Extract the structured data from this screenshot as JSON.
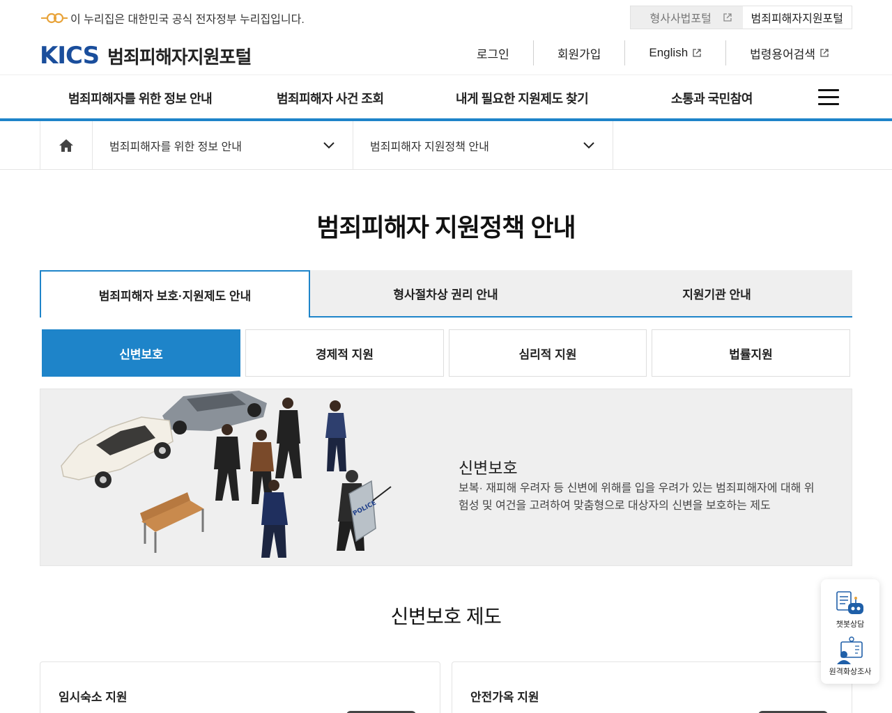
{
  "gov_bar": {
    "notice": "이 누리집은 대한민국 공식 전자정부 누리집입니다.",
    "links": [
      {
        "label": "형사사법포털"
      },
      {
        "label": "범죄피해자지원포털"
      }
    ]
  },
  "header": {
    "logo_mark": "KICS",
    "logo_text": "범죄피해자지원포털",
    "util_links": [
      {
        "label": "로그인"
      },
      {
        "label": "회원가입"
      },
      {
        "label": "English"
      },
      {
        "label": "법령용어검색"
      }
    ]
  },
  "gnb": {
    "items": [
      {
        "label": "범죄피해자를 위한 정보 안내"
      },
      {
        "label": "범죄피해자 사건 조회"
      },
      {
        "label": "내게 필요한 지원제도 찾기"
      },
      {
        "label": "소통과 국민참여"
      }
    ]
  },
  "breadcrumb": {
    "level1": "범죄피해자를 위한 정보 안내",
    "level2": "범죄피해자 지원정책 안내"
  },
  "page": {
    "title": "범죄피해자 지원정책 안내"
  },
  "tabs": [
    {
      "label": "범죄피해자 보호·지원제도 안내"
    },
    {
      "label": "형사절차상 권리 안내"
    },
    {
      "label": "지원기관 안내"
    }
  ],
  "subtabs": [
    {
      "label": "신변보호"
    },
    {
      "label": "경제적 지원"
    },
    {
      "label": "심리적 지원"
    },
    {
      "label": "법률지원"
    }
  ],
  "banner": {
    "title": "신변보호",
    "description": "보복· 재피해 우려자 등 신변에 위해를 입을 우려가 있는 범죄피해자에 대해 위험성 및 여건을 고려하여 맞춤형으로 대상자의 신변을 보호하는 제도",
    "police_text": "POLICE"
  },
  "section": {
    "title": "신변보호 제도",
    "cards": [
      {
        "title": "임시숙소 지원"
      },
      {
        "title": "안전가옥 지원"
      }
    ]
  },
  "floating": {
    "chatbot": "챗봇상담",
    "video": "원격화상조사"
  },
  "colors": {
    "accent": "#1e84c9",
    "logo": "#1a4e9c",
    "gov_mark": "#e8a33a"
  }
}
